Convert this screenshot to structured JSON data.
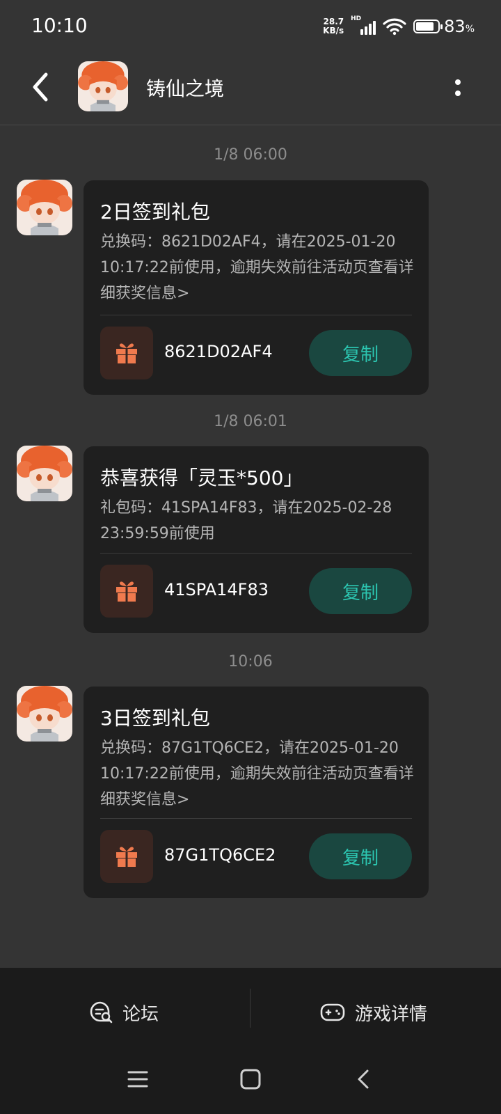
{
  "status_bar": {
    "time": "10:10",
    "net_speed_value": "28.7",
    "net_speed_unit": "KB/s",
    "hd": "HD",
    "battery_percent": "83",
    "battery_sign": "%",
    "battery_level": 0.83
  },
  "header": {
    "title": "铸仙之境"
  },
  "messages": [
    {
      "timestamp": "1/8  06:00",
      "title": "2日签到礼包",
      "body": "兑换码：8621D02AF4，请在2025-01-20 10:17:22前使用，逾期失效前往活动页查看详细获奖信息>",
      "code": "8621D02AF4",
      "copy_label": "复制"
    },
    {
      "timestamp": "1/8  06:01",
      "title": "恭喜获得「灵玉*500」",
      "body": "礼包码：41SPA14F83，请在2025-02-28 23:59:59前使用",
      "code": "41SPA14F83",
      "copy_label": "复制"
    },
    {
      "timestamp": "10:06",
      "title": "3日签到礼包",
      "body": "兑换码：87G1TQ6CE2，请在2025-01-20 10:17:22前使用，逾期失效前往活动页查看详细获奖信息>",
      "code": "87G1TQ6CE2",
      "copy_label": "复制"
    }
  ],
  "bottom_tabs": {
    "forum": "论坛",
    "game_details": "游戏详情"
  },
  "icons": {
    "back": "chevron-left-icon",
    "more": "more-vertical-icon",
    "gift": "gift-icon",
    "forum": "chat-search-icon",
    "game": "gamepad-icon"
  },
  "colors": {
    "background": "#343434",
    "card": "#1f1f1f",
    "accent": "#2cc6b1",
    "copy_bg": "#1a4740",
    "gift": "#f07a4e",
    "gift_bg": "#3a2621"
  }
}
